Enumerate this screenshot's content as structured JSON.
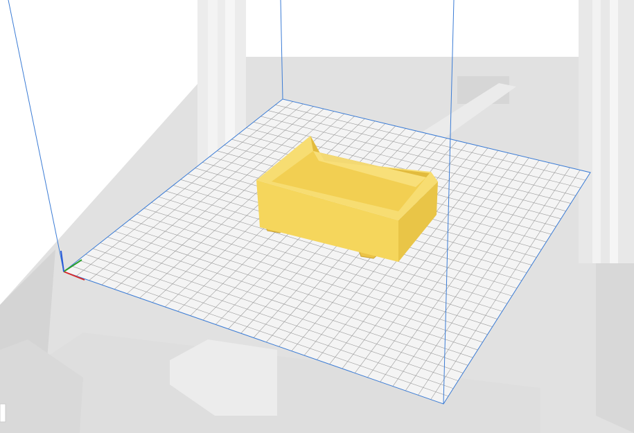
{
  "app": {
    "view": "3d-build-plate-viewport",
    "model": "yellow-cart-box-with-wheels"
  },
  "colors": {
    "background": "#ffffff",
    "printer_body": "#dcdcdc",
    "printer_frame": "#e6e6e6",
    "build_plate": "#f4f4f4",
    "grid_line": "#9a9a9a",
    "build_volume_edge": "#3a7bd5",
    "model_fill": "#f5d65c",
    "model_shadow": "#e4bd3e",
    "model_highlight": "#fbe58a",
    "axis_x": "#d92b2b",
    "axis_y": "#2aa02a",
    "axis_z": "#2b5bd9"
  },
  "icons": {
    "axis_gizmo": "xyz-axis-icon"
  }
}
